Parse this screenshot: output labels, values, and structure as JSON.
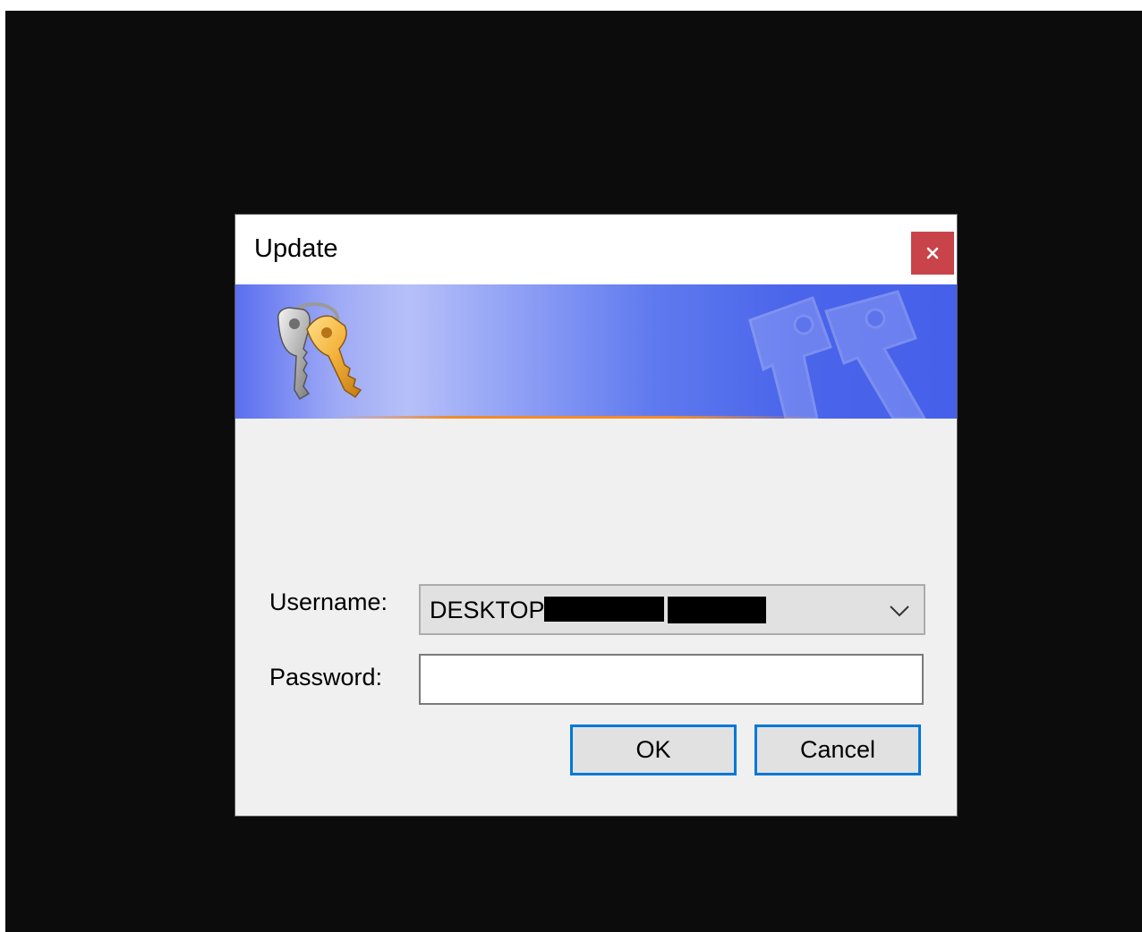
{
  "dialog": {
    "title": "Update",
    "close_icon": "close-icon",
    "banner_icon": "keys-icon"
  },
  "form": {
    "username_label": "Username:",
    "username_value": "DESKTOP-",
    "password_label": "Password:",
    "password_value": ""
  },
  "buttons": {
    "ok_label": "OK",
    "cancel_label": "Cancel"
  },
  "colors": {
    "close_button": "#c8434a",
    "button_focus_border": "#0078d7",
    "banner_blue": "#4a64ea",
    "banner_stripe": "#f08a2a"
  }
}
